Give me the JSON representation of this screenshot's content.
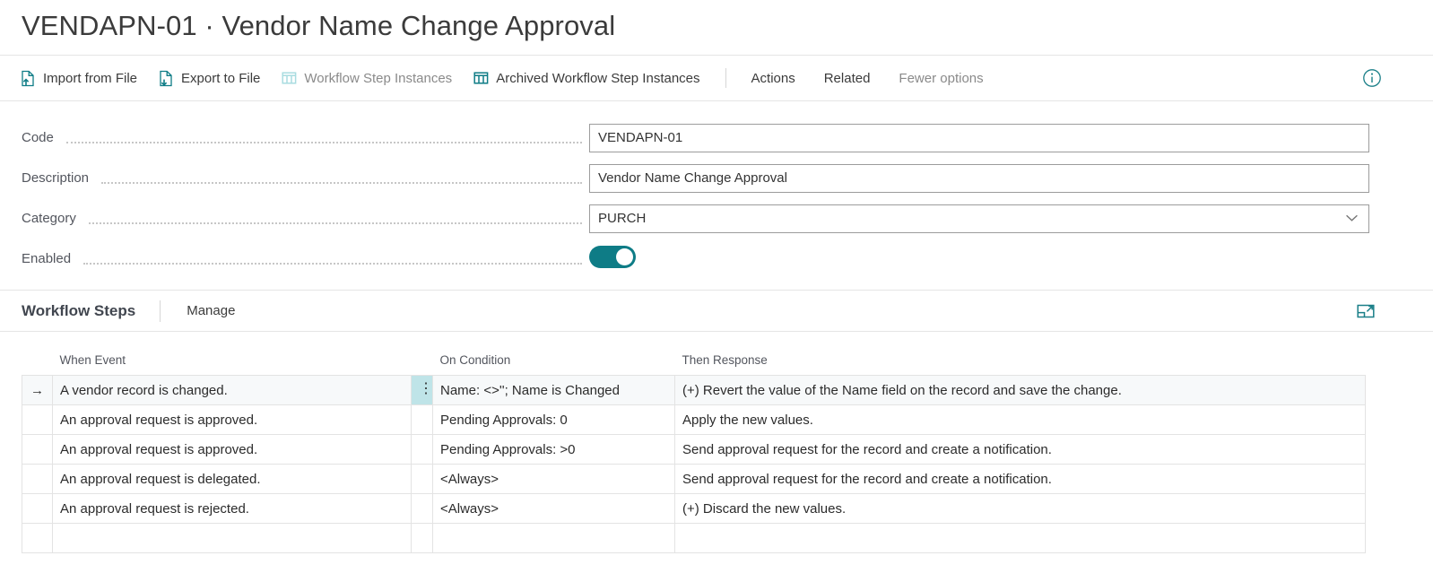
{
  "page": {
    "title": "VENDAPN-01 · Vendor Name Change Approval"
  },
  "toolbar": {
    "items": [
      {
        "label": "Import from File",
        "icon": "import-file-icon",
        "disabled": false
      },
      {
        "label": "Export to File",
        "icon": "export-file-icon",
        "disabled": false
      },
      {
        "label": "Workflow Step Instances",
        "icon": "grid-table-icon",
        "disabled": true
      },
      {
        "label": "Archived Workflow Step Instances",
        "icon": "grid-table-icon",
        "disabled": false
      }
    ],
    "menus": [
      {
        "label": "Actions",
        "muted": false
      },
      {
        "label": "Related",
        "muted": false
      },
      {
        "label": "Fewer options",
        "muted": true
      }
    ],
    "info_icon": "info-circle-icon"
  },
  "form": {
    "fields": [
      {
        "label": "Code",
        "value": "VENDAPN-01",
        "type": "text"
      },
      {
        "label": "Description",
        "value": "Vendor Name Change Approval",
        "type": "text"
      },
      {
        "label": "Category",
        "value": "PURCH",
        "type": "select"
      },
      {
        "label": "Enabled",
        "value": "On",
        "type": "toggle"
      }
    ]
  },
  "section": {
    "title": "Workflow Steps",
    "action": "Manage",
    "expand_icon": "open-in-new-window-icon"
  },
  "grid": {
    "columns": [
      "When Event",
      "On Condition",
      "Then Response"
    ],
    "rows": [
      {
        "indicator": "→",
        "event": "A vendor record is changed.",
        "condition": "Name: <>''; Name is Changed",
        "response": "(+) Revert the value of the Name field on the record and save the change.",
        "selected": true,
        "condition_is_link": true,
        "response_is_link": true
      },
      {
        "indicator": "",
        "event": "An approval request is approved.",
        "condition": "Pending Approvals: 0",
        "response": "Apply the new values.",
        "selected": false,
        "condition_is_link": true,
        "response_is_link": false
      },
      {
        "indicator": "",
        "event": "An approval request is approved.",
        "condition": "Pending Approvals: >0",
        "response": "Send approval request for the record and create a notification.",
        "selected": false,
        "condition_is_link": true,
        "response_is_link": false
      },
      {
        "indicator": "",
        "event": "An approval request is delegated.",
        "condition": "<Always>",
        "response": "Send approval request for the record and create a notification.",
        "selected": false,
        "condition_is_link": true,
        "response_is_link": false
      },
      {
        "indicator": "",
        "event": "An approval request is rejected.",
        "condition": "<Always>",
        "response": "(+) Discard the new values.",
        "selected": false,
        "condition_is_link": true,
        "response_is_link": true
      },
      {
        "indicator": "",
        "event": "",
        "condition": "",
        "response": "",
        "selected": false,
        "condition_is_link": false,
        "response_is_link": false
      }
    ],
    "row_menu_glyph": "⋮"
  },
  "colors": {
    "accent": "#0e7c86",
    "accent_pale": "#a9dce0",
    "selected_cell": "#bfe4e8",
    "text": "#2b2b2b",
    "muted_text": "#8a8a8a"
  }
}
